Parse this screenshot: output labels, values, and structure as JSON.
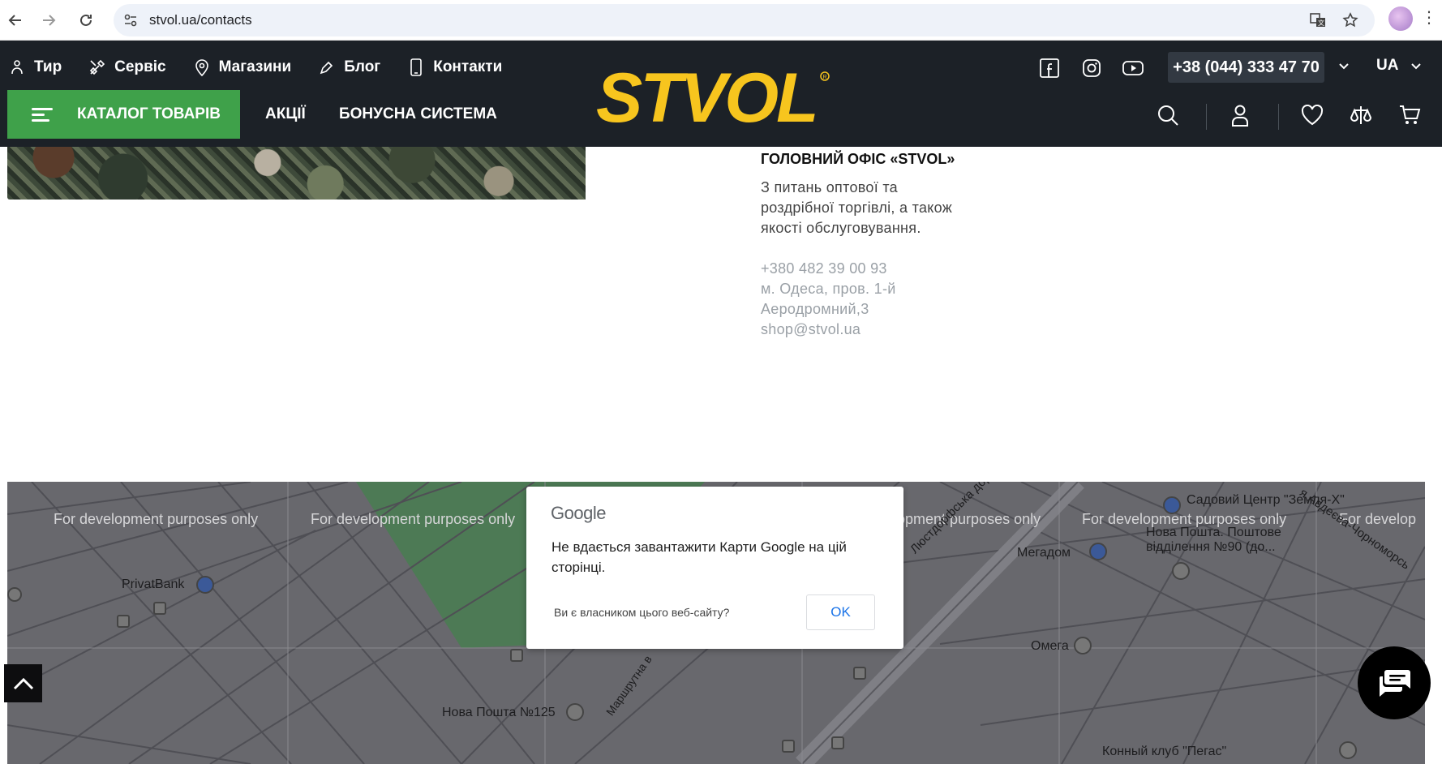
{
  "browser": {
    "url": "stvol.ua/contacts"
  },
  "topnav": [
    {
      "label": "Тир",
      "icon": "shooting-range-icon"
    },
    {
      "label": "Сервіс",
      "icon": "tools-icon"
    },
    {
      "label": "Магазини",
      "icon": "map-pin-icon"
    },
    {
      "label": "Блог",
      "icon": "pen-icon"
    },
    {
      "label": "Контакти",
      "icon": "phone-icon"
    }
  ],
  "header": {
    "catalog_label": "КАТАЛОГ ТОВАРІВ",
    "promo_label": "АКЦІЇ",
    "bonus_label": "БОНУСНА СИСТЕМА",
    "logo_text": "STVOL",
    "phone": "+38 (044) 333 47 70",
    "lang": "UA",
    "brand_yellow": "#f7c51e",
    "catalog_green": "#3fa14a"
  },
  "office": {
    "title": "ГОЛОВНИЙ ОФІС «STVOL»",
    "desc": "З питань оптової та роздрібної торгівлі, а також якості обслуговування.",
    "phone": "+380 482 39 00 93",
    "address": "м. Одеса, пров. 1-й Аеродромний,3",
    "email": "shop@stvol.ua"
  },
  "map": {
    "dev_text": "For development purposes only",
    "dev_text_partial_1": "opment purposes only",
    "dev_text_partial_2": "For develop",
    "pois": {
      "privatbank": "PrivatBank",
      "sadovyi": "Садовий Центр \"Земля-Х\"",
      "novaposhta90": "Нова Пошта. Поштове відділення №90 (до...",
      "megadom": "Мегадом",
      "omega": "Омега",
      "novaposhta125": "Нова Пошта №125",
      "pegas": "Конный клуб \"Пегас\"",
      "road1": "Люстдорфська дорога",
      "road2": "Маршрутна в",
      "road3": "я Авдеєва-Чорноморсь"
    }
  },
  "dialog": {
    "logo": "Google",
    "message": "Не вдається завантажити Карти Google на цій сторінці.",
    "owner_link": "Ви є власником цього веб-сайту?",
    "ok_label": "OK"
  }
}
